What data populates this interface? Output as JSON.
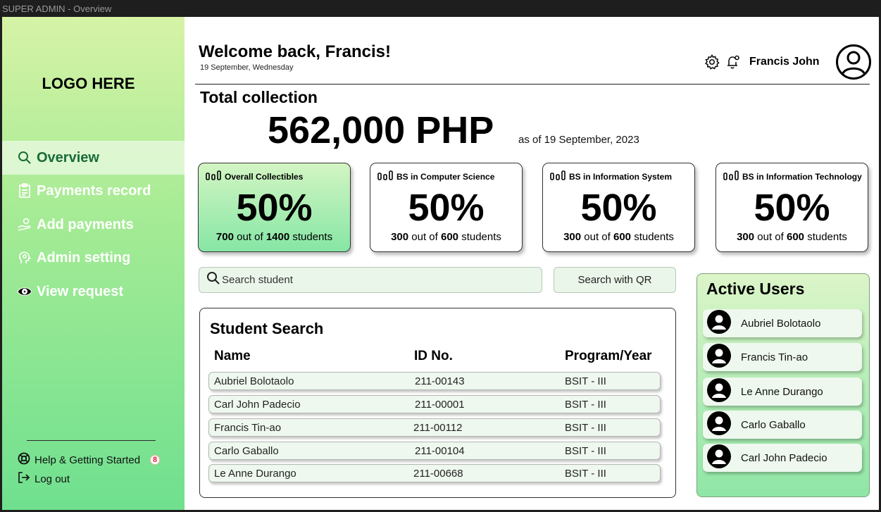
{
  "window": {
    "title": "SUPER ADMIN - Overview"
  },
  "sidebar": {
    "logo": "LOGO HERE",
    "items": [
      {
        "label": "Overview",
        "icon": "search-icon",
        "active": true
      },
      {
        "label": "Payments record",
        "icon": "clipboard-icon",
        "active": false
      },
      {
        "label": "Add payments",
        "icon": "hand-coin-icon",
        "active": false
      },
      {
        "label": "Admin setting",
        "icon": "head-gear-icon",
        "active": false
      },
      {
        "label": "View request",
        "icon": "eye-icon",
        "active": false
      }
    ],
    "footer": {
      "help_label": "Help & Getting Started",
      "help_badge": "8",
      "logout_label": "Log out"
    }
  },
  "header": {
    "welcome": "Welcome back, Francis!",
    "date": "19 September, Wednesday",
    "user_name": "Francis John"
  },
  "total": {
    "label": "Total collection",
    "amount": "562,000 PHP",
    "as_of": "as of 19 September, 2023"
  },
  "cards": [
    {
      "title": "Overall Collectibles",
      "percent": "50%",
      "count": "700",
      "out_of_word": "out of",
      "total": "1400",
      "unit": "students"
    },
    {
      "title": "BS in Computer Science",
      "percent": "50%",
      "count": "300",
      "out_of_word": "out of",
      "total": "600",
      "unit": "students"
    },
    {
      "title": "BS in Information System",
      "percent": "50%",
      "count": "300",
      "out_of_word": "out of",
      "total": "600",
      "unit": "students"
    },
    {
      "title": "BS in Information Technology",
      "percent": "50%",
      "count": "300",
      "out_of_word": "out of",
      "total": "600",
      "unit": "students"
    }
  ],
  "search": {
    "placeholder": "Search student",
    "qr_label": "Search with QR"
  },
  "student_search": {
    "title": "Student Search",
    "columns": [
      "Name",
      "ID No.",
      "Program/Year"
    ],
    "rows": [
      {
        "name": "Aubriel Bolotaolo",
        "id": "211-00143",
        "program": "BSIT - III"
      },
      {
        "name": "Carl John Padecio",
        "id": "211-00001",
        "program": "BSIT - III"
      },
      {
        "name": "Francis Tin-ao",
        "id": "211-00112",
        "program": "BSIT - III"
      },
      {
        "name": "Carlo Gaballo",
        "id": "211-00104",
        "program": "BSIT - III"
      },
      {
        "name": "Le Anne Durango",
        "id": "211-00668",
        "program": "BSIT - III"
      }
    ]
  },
  "active_users": {
    "title": "Active Users",
    "users": [
      {
        "name": "Aubriel Bolotaolo"
      },
      {
        "name": "Francis Tin-ao"
      },
      {
        "name": "Le Anne Durango"
      },
      {
        "name": "Carlo Gaballo"
      },
      {
        "name": "Carl John Padecio"
      }
    ]
  }
}
